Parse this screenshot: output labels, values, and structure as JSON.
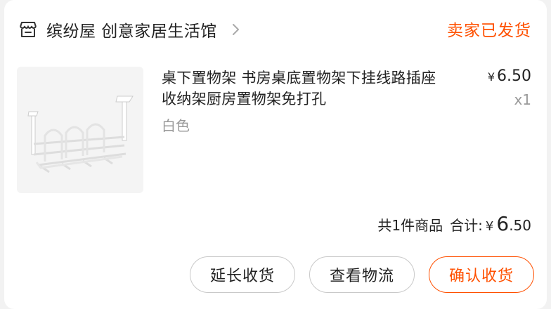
{
  "shop": {
    "name": "缤纷屋 创意家居生活馆",
    "status": "卖家已发货",
    "icon": "store-icon"
  },
  "item": {
    "title": "桌下置物架 书房桌底置物架下挂线路插座收纳架厨房置物架免打孔",
    "variant": "白色",
    "price_currency": "¥",
    "price": "6.50",
    "quantity": "x1",
    "image": "cable-tray-image"
  },
  "summary": {
    "count_text": "共1件商品",
    "total_label": "合计:",
    "currency": "¥",
    "total_int": "6",
    "total_dec": ".50"
  },
  "actions": {
    "extend": "延长收货",
    "logistics": "查看物流",
    "confirm": "确认收货"
  },
  "colors": {
    "accent": "#ff5000",
    "muted": "#999999",
    "border": "#c9c9c9"
  }
}
